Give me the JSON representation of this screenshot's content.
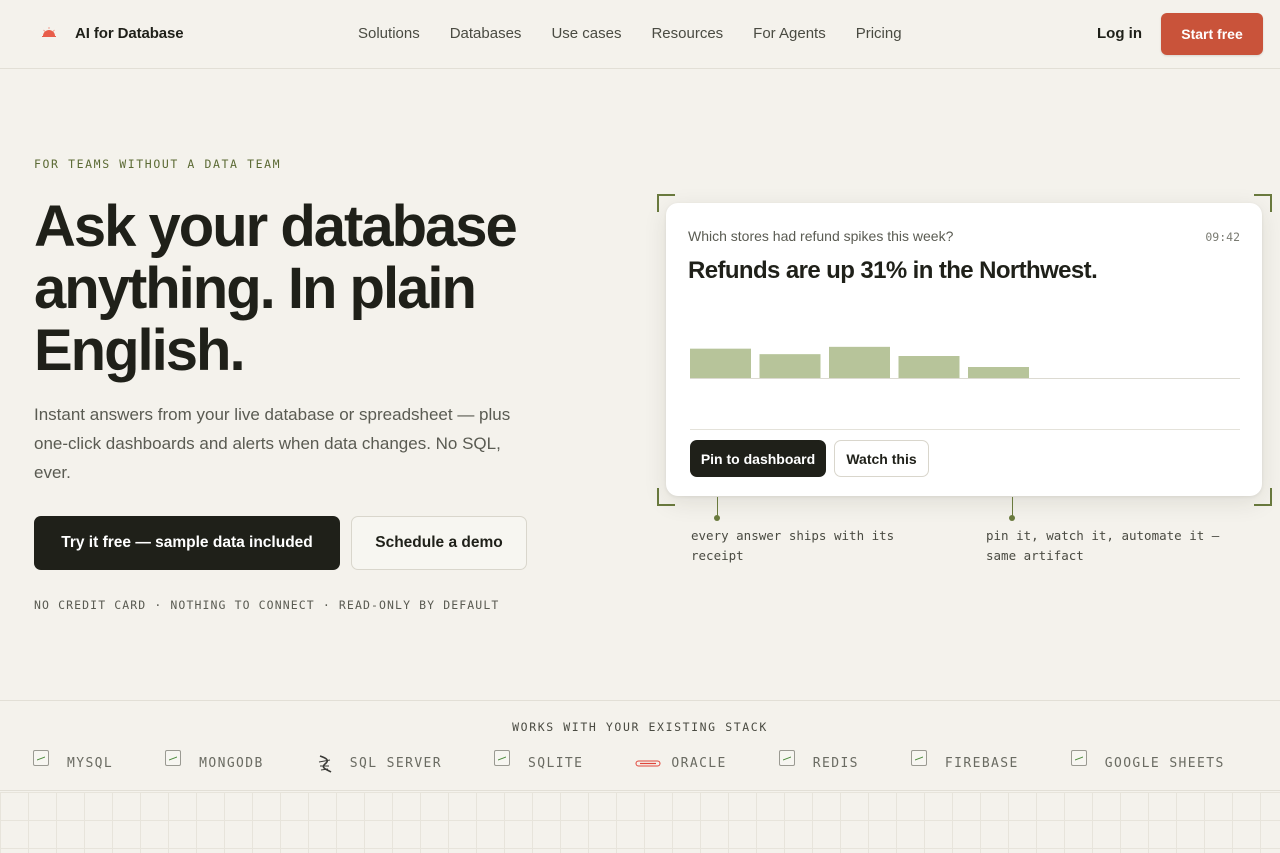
{
  "brand": {
    "name": "AI for Database",
    "logo_icon": "sun-half-icon",
    "accent": "#c9533a"
  },
  "nav": {
    "links": [
      "Solutions",
      "Databases",
      "Use cases",
      "Resources",
      "For Agents",
      "Pricing"
    ],
    "login": "Log in",
    "cta": "Start free"
  },
  "hero": {
    "eyebrow": "FOR TEAMS WITHOUT A DATA TEAM",
    "headline": "Ask your database anything. In plain English.",
    "subtext": "Instant answers from your live database or spreadsheet — plus one-click dashboards and alerts when data changes. No SQL, ever.",
    "primary_cta": "Try it free — sample data included",
    "secondary_cta": "Schedule a demo",
    "fineprint": "NO CREDIT CARD · NOTHING TO CONNECT · READ-ONLY BY DEFAULT"
  },
  "card": {
    "question": "Which stores had refund spikes this week?",
    "time": "09:42",
    "answer": "Refunds are up 31% in the Northwest.",
    "pin_button": "Pin to dashboard",
    "watch_button": "Watch this",
    "bar_color": "#b7c49a"
  },
  "chart_data": {
    "type": "bar",
    "values": [
      32,
      26,
      34,
      24,
      12
    ],
    "ylim": [
      0,
      60
    ]
  },
  "annotations": {
    "left": "every answer ships with its receipt",
    "right": "pin it, watch it, automate it — same artifact"
  },
  "stack": {
    "title": "WORKS WITH YOUR EXISTING STACK",
    "items": [
      {
        "name": "MYSQL",
        "icon": "broken-image-icon"
      },
      {
        "name": "MONGODB",
        "icon": "broken-image-icon"
      },
      {
        "name": "SQL SERVER",
        "icon": "sql-server-icon"
      },
      {
        "name": "SQLITE",
        "icon": "broken-image-icon"
      },
      {
        "name": "ORACLE",
        "icon": "oracle-icon"
      },
      {
        "name": "REDIS",
        "icon": "broken-image-icon"
      },
      {
        "name": "FIREBASE",
        "icon": "broken-image-icon"
      },
      {
        "name": "GOOGLE SHEETS",
        "icon": "broken-image-icon"
      },
      {
        "name": "",
        "icon": "slack-icon"
      }
    ]
  }
}
